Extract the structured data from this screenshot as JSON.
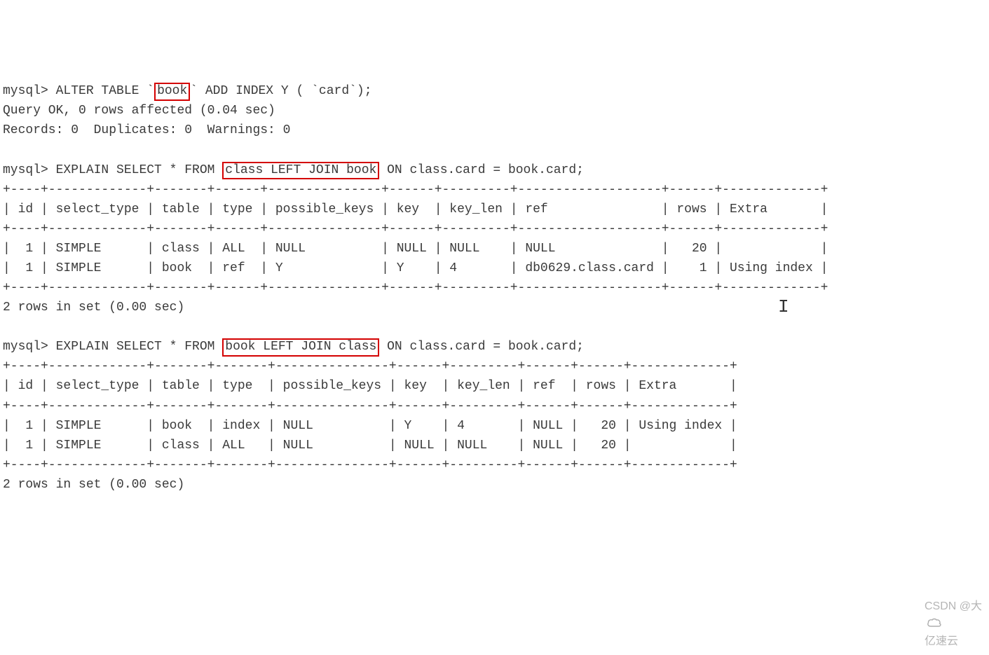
{
  "line1_prompt": "mysql> ",
  "line1_a": "ALTER TABLE `",
  "line1_hl": "book",
  "line1_b": "` ADD INDEX Y ( `card`);",
  "line2": "Query OK, 0 rows affected (0.04 sec)",
  "line3": "Records: 0  Duplicates: 0  Warnings: 0",
  "line5_prompt": "mysql> ",
  "line5_a": "EXPLAIN SELECT * FROM ",
  "line5_hl": "class LEFT JOIN book",
  "line5_b": " ON class.card = book.card;",
  "t1_border": "+----+-------------+-------+------+---------------+------+---------+-------------------+------+-------------+",
  "t1_header": "| id | select_type | table | type | possible_keys | key  | key_len | ref               | rows | Extra       |",
  "t1_r1": "|  1 | SIMPLE      | class | ALL  | NULL          | NULL | NULL    | NULL              |   20 |             |",
  "t1_r2": "|  1 | SIMPLE      | book  | ref  | Y             | Y    | 4       | db0629.class.card |    1 | Using index |",
  "t1_footer": "2 rows in set (0.00 sec)",
  "line15_prompt": "mysql> ",
  "line15_a": "EXPLAIN SELECT * FROM ",
  "line15_hl": "book LEFT JOIN class",
  "line15_b": " ON class.card = book.card;",
  "t2_border": "+----+-------------+-------+-------+---------------+------+---------+------+------+-------------+",
  "t2_header": "| id | select_type | table | type  | possible_keys | key  | key_len | ref  | rows | Extra       |",
  "t2_r1": "|  1 | SIMPLE      | book  | index | NULL          | Y    | 4       | NULL |   20 | Using index |",
  "t2_r2": "|  1 | SIMPLE      | class | ALL   | NULL          | NULL | NULL    | NULL |   20 |             |",
  "t2_footer": "2 rows in set (0.00 sec)",
  "watermark_a": "CSDN @大",
  "watermark_b": "亿速云",
  "chart_data": {
    "type": "table",
    "tables": [
      {
        "query": "EXPLAIN SELECT * FROM class LEFT JOIN book ON class.card = book.card",
        "columns": [
          "id",
          "select_type",
          "table",
          "type",
          "possible_keys",
          "key",
          "key_len",
          "ref",
          "rows",
          "Extra"
        ],
        "rows": [
          [
            1,
            "SIMPLE",
            "class",
            "ALL",
            "NULL",
            "NULL",
            "NULL",
            "NULL",
            20,
            ""
          ],
          [
            1,
            "SIMPLE",
            "book",
            "ref",
            "Y",
            "Y",
            4,
            "db0629.class.card",
            1,
            "Using index"
          ]
        ]
      },
      {
        "query": "EXPLAIN SELECT * FROM book LEFT JOIN class ON class.card = book.card",
        "columns": [
          "id",
          "select_type",
          "table",
          "type",
          "possible_keys",
          "key",
          "key_len",
          "ref",
          "rows",
          "Extra"
        ],
        "rows": [
          [
            1,
            "SIMPLE",
            "book",
            "index",
            "NULL",
            "Y",
            4,
            "NULL",
            20,
            "Using index"
          ],
          [
            1,
            "SIMPLE",
            "class",
            "ALL",
            "NULL",
            "NULL",
            "NULL",
            "NULL",
            20,
            ""
          ]
        ]
      }
    ]
  }
}
